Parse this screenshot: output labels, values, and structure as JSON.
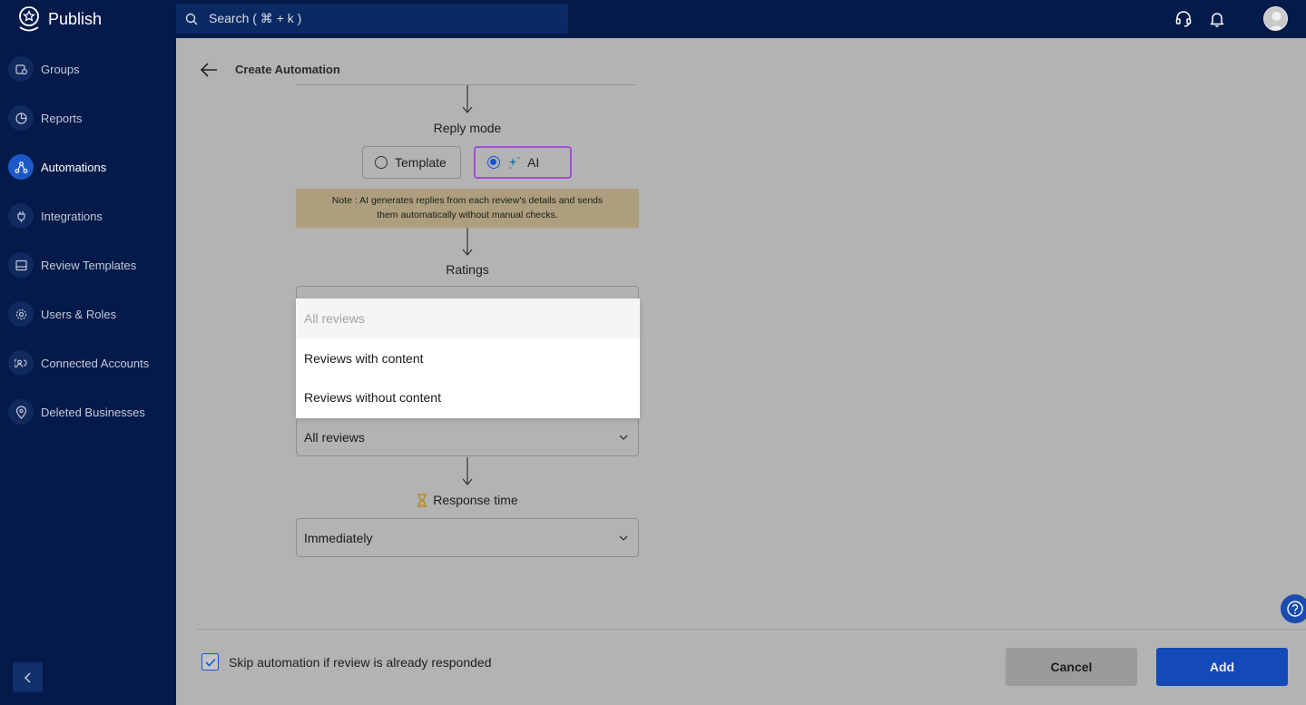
{
  "app": {
    "name": "Publish"
  },
  "search": {
    "placeholder": "Search ( ⌘ + k )"
  },
  "topbar": {
    "support_icon": "headset-icon",
    "notifications_icon": "bell-icon",
    "avatar": "user-avatar"
  },
  "sidebar": {
    "items": [
      {
        "label": "Groups",
        "icon": "groups-icon",
        "active": false
      },
      {
        "label": "Reports",
        "icon": "pie-chart-icon",
        "active": false
      },
      {
        "label": "Automations",
        "icon": "automation-icon",
        "active": true
      },
      {
        "label": "Integrations",
        "icon": "plug-icon",
        "active": false
      },
      {
        "label": "Review Templates",
        "icon": "template-icon",
        "active": false
      },
      {
        "label": "Users & Roles",
        "icon": "gear-icon",
        "active": false
      },
      {
        "label": "Connected Accounts",
        "icon": "connected-accounts-icon",
        "active": false
      },
      {
        "label": "Deleted Businesses",
        "icon": "location-pin-icon",
        "active": false
      }
    ],
    "collapse_icon": "chevron-left-icon"
  },
  "page": {
    "title": "Create Automation",
    "reply_mode": {
      "label": "Reply mode",
      "options": [
        {
          "label": "Template",
          "selected": false
        },
        {
          "label": "AI",
          "selected": true
        }
      ],
      "note": "Note : AI generates replies from each review's details and sends them automatically without manual checks."
    },
    "ratings": {
      "label": "Ratings"
    },
    "review_filter": {
      "value": "All reviews",
      "options": [
        "All reviews",
        "Reviews with content",
        "Reviews without content"
      ]
    },
    "response_time": {
      "label": "Response time",
      "value": "Immediately"
    }
  },
  "footer": {
    "skip_label": "Skip automation if review is already responded",
    "skip_checked": true,
    "cancel_label": "Cancel",
    "add_label": "Add"
  },
  "colors": {
    "nav_bg": "#041a4a",
    "accent": "#1457d8",
    "ai_border": "#a34bd9",
    "note_bg": "#ad9f7e"
  }
}
